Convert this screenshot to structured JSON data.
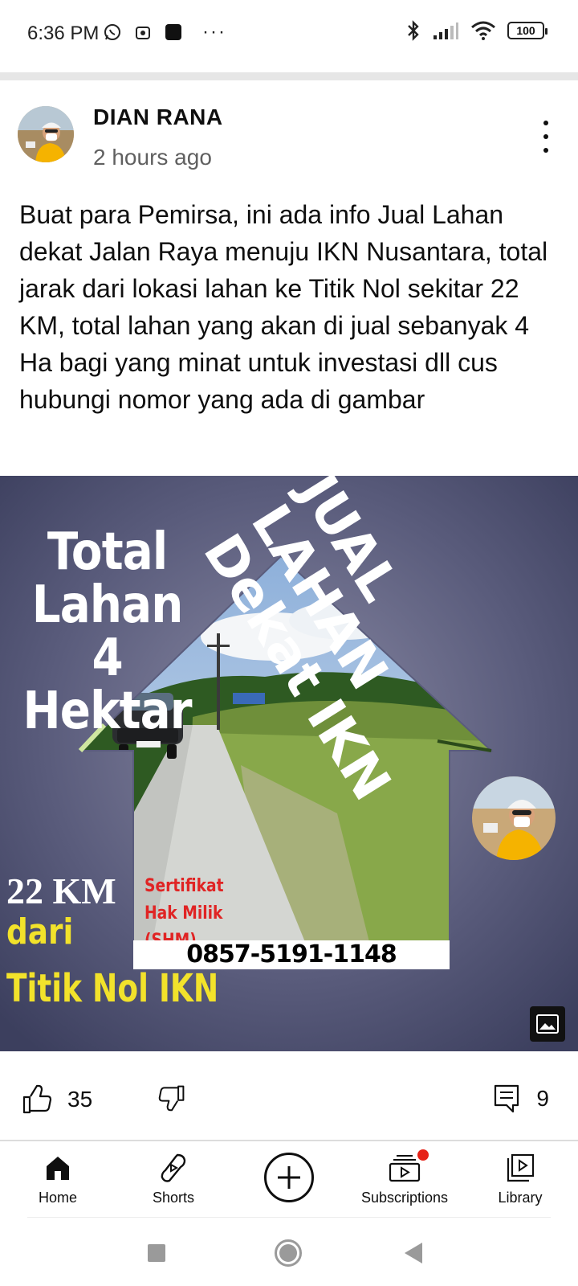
{
  "status_bar": {
    "time": "6:36 PM",
    "left_icons": [
      "whatsapp-icon",
      "notification-icon",
      "app-icon"
    ],
    "more": "···",
    "battery": "100",
    "right_icons": [
      "bluetooth-icon",
      "signal-icon",
      "wifi-icon",
      "battery-icon"
    ]
  },
  "post": {
    "author": "DIAN RANA",
    "time_ago": "2 hours ago",
    "text": "Buat para Pemirsa, ini ada info Jual Lahan dekat Jalan Raya menuju IKN Nusantara, total jarak dari lokasi lahan ke Titik Nol sekitar 22 KM, total lahan yang akan di jual sebanyak 4 Ha bagi yang minat untuk investasi dll cus hubungi nomor yang ada di gambar",
    "image": {
      "total_line1": "Total Lahan",
      "total_line2": "4 Hektar",
      "headline": "JUAL\nLAHAN\nDekat IKN",
      "distance": "22 KM",
      "dari": "dari",
      "titik_nol": "Titik Nol IKN",
      "certificate": "Sertifikat Hak Milik (SHM)",
      "phone": "0857-5191-1148"
    },
    "likes": "35",
    "comments": "9"
  },
  "bottom_nav": {
    "home": "Home",
    "shorts": "Shorts",
    "create": "",
    "subscriptions": "Subscriptions",
    "library": "Library"
  },
  "colors": {
    "image_bg": "#4e5170",
    "yellow": "#f2e22b",
    "red_text": "#e02424",
    "notification": "#e62117"
  }
}
